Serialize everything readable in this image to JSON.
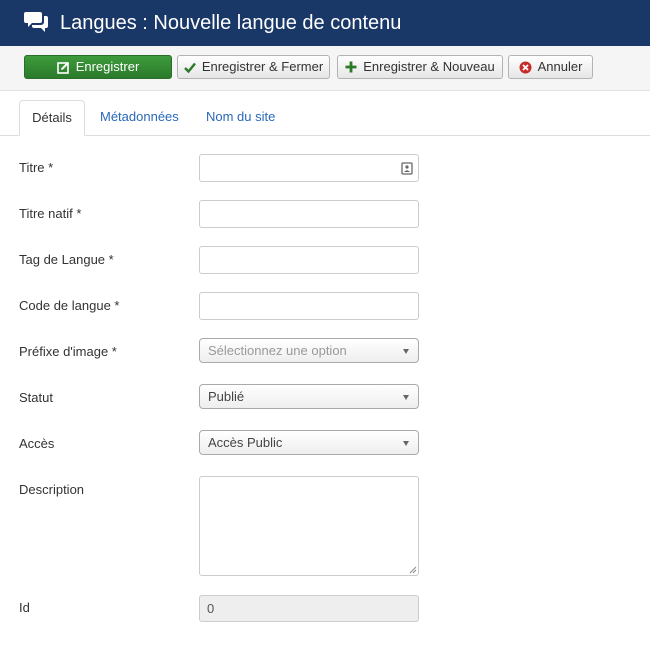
{
  "header": {
    "title": "Langues : Nouvelle langue de contenu",
    "icon": "comments-icon",
    "bg_color": "#1a3867"
  },
  "toolbar": {
    "save_label": "Enregistrer",
    "save_close_label": "Enregistrer & Fermer",
    "save_new_label": "Enregistrer & Nouveau",
    "cancel_label": "Annuler",
    "save_color": "#3d9b3c"
  },
  "tabs": [
    {
      "label": "Détails",
      "active": true
    },
    {
      "label": "Métadonnées",
      "active": false
    },
    {
      "label": "Nom du site",
      "active": false
    }
  ],
  "form": {
    "title": {
      "label": "Titre *",
      "value": ""
    },
    "native_title": {
      "label": "Titre natif *",
      "value": ""
    },
    "lang_tag": {
      "label": "Tag de Langue *",
      "value": ""
    },
    "lang_code": {
      "label": "Code de langue *",
      "value": ""
    },
    "image_prefix": {
      "label": "Préfixe d'image *",
      "placeholder": "Sélectionnez une option"
    },
    "status": {
      "label": "Statut",
      "value": "Publié"
    },
    "access": {
      "label": "Accès",
      "value": "Accès Public"
    },
    "description": {
      "label": "Description",
      "value": ""
    },
    "id": {
      "label": "Id",
      "value": "0"
    }
  },
  "colors": {
    "link": "#2a69b8"
  }
}
